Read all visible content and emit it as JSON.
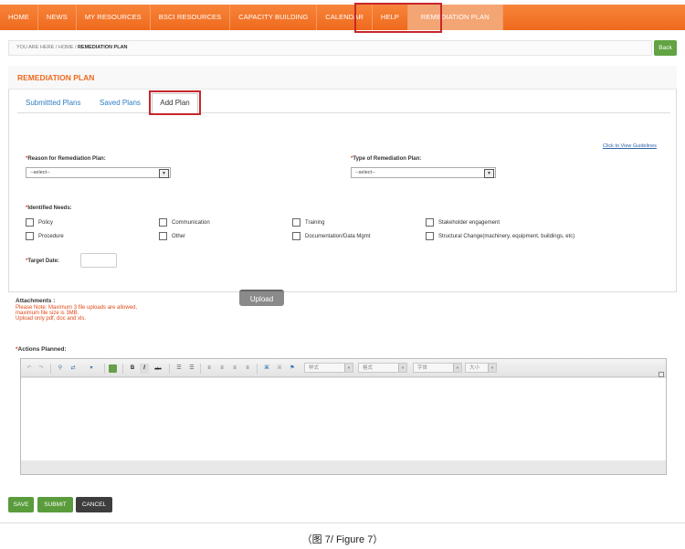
{
  "nav": {
    "items": [
      "HOME",
      "NEWS",
      "MY RESOURCES",
      "BSCI RESOURCES",
      "CAPACITY BUILDING",
      "CALENDAR",
      "HELP",
      "REMEDIATION PLAN"
    ]
  },
  "breadcrumb": {
    "prefix": "YOU ARE HERE / HOME / ",
    "current": "REMEDIATION PLAN"
  },
  "back_label": "Back",
  "panel": {
    "title": "REMEDIATION PLAN"
  },
  "tabs": [
    "Submittted Plans",
    "Saved Plans",
    "Add Plan"
  ],
  "guidelines_link": "Click to View Guidelines",
  "form": {
    "reason_label": "Reason for Remediation Plan:",
    "reason_value": "--select--",
    "type_label": "Type of Remediation Plan:",
    "type_value": "--select--",
    "needs_label": "Identified Needs:",
    "needs": [
      "Policy",
      "Communication",
      "Training",
      "Stakeholder engagement",
      "Procedure",
      "Other",
      "Documentation/Data Mgmt",
      "Structural Change(machinery, equipment, buildings, etc)"
    ],
    "target_label": "Target Date:",
    "required_mark": "*"
  },
  "attachments": {
    "label": "Attachments :",
    "note1": "Please Note: Maximum 3 file uploads are allowed,",
    "note2": "maximum file size is 3MB.",
    "note3": "Upload only pdf, doc and xls.",
    "upload_label": "Upload"
  },
  "actions_label": "Actions Planned:",
  "editor": {
    "dropdowns": [
      "样式",
      "格式",
      "字体",
      "大小"
    ]
  },
  "buttons": {
    "save": "SAVE",
    "submit": "SUBMIT",
    "cancel": "CANCEL"
  },
  "caption": "（图 7/ Figure 7）",
  "colors": {
    "accent": "#ef6a1d",
    "highlight": "#c8262b",
    "green": "#5a9c3c",
    "link": "#2f7fc1"
  }
}
